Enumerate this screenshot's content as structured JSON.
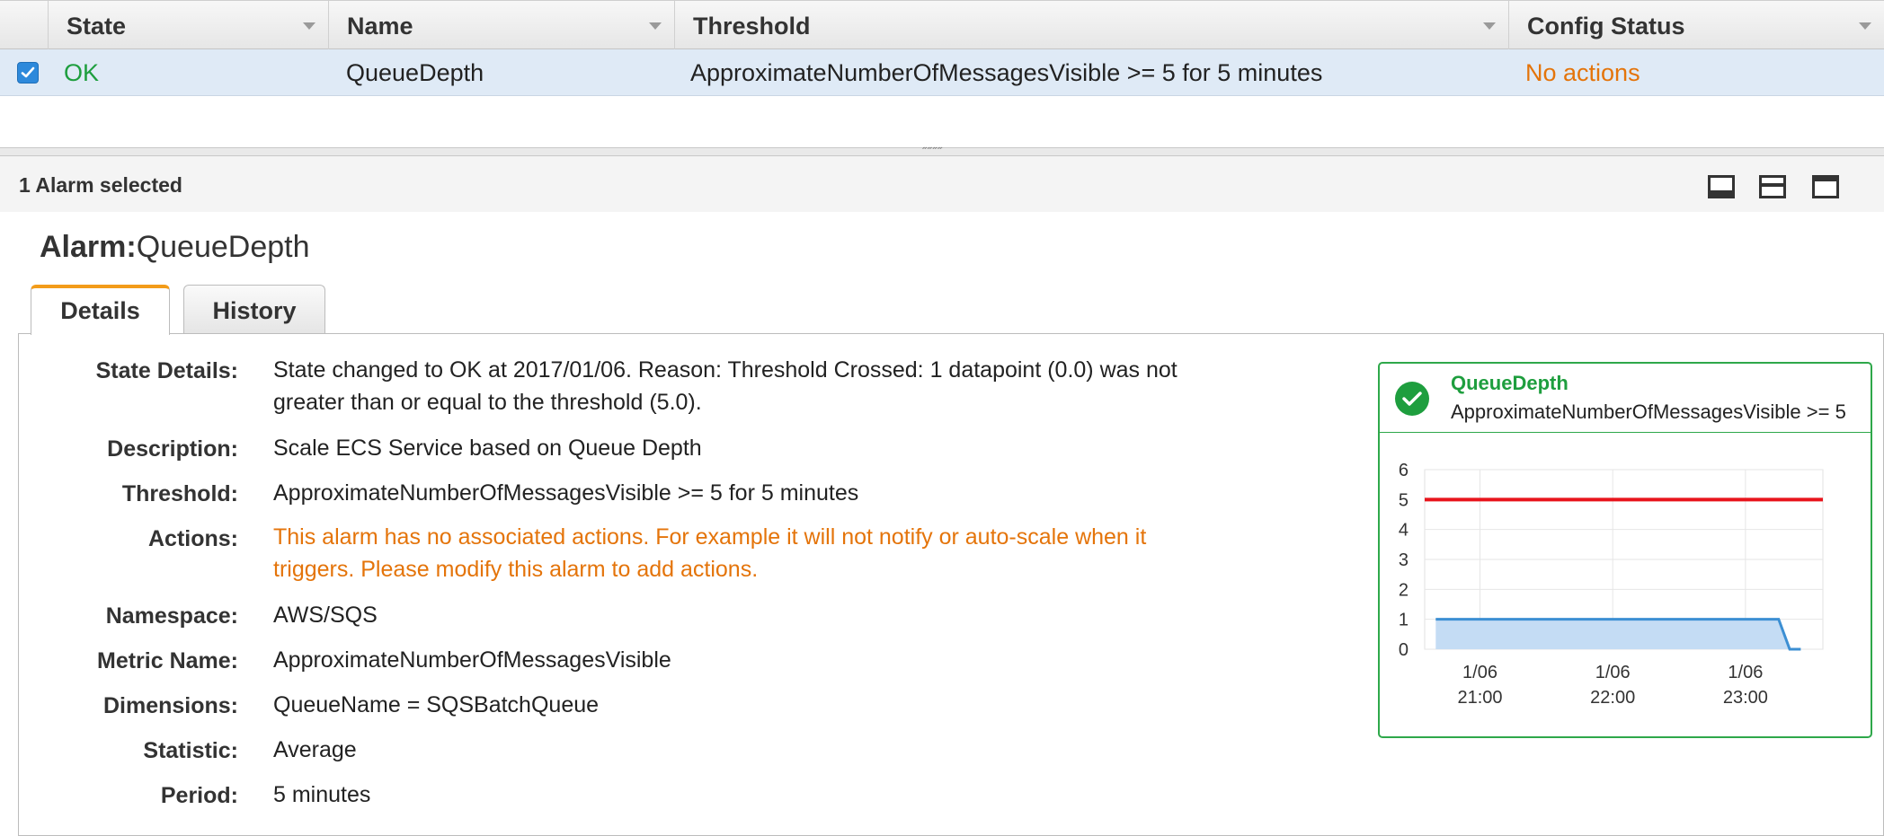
{
  "table": {
    "columns": [
      {
        "label": "State"
      },
      {
        "label": "Name"
      },
      {
        "label": "Threshold"
      },
      {
        "label": "Config Status"
      }
    ],
    "row": {
      "selected": true,
      "state": "OK",
      "name": "QueueDepth",
      "threshold": "ApproximateNumberOfMessagesVisible >= 5 for 5 minutes",
      "config_status": "No actions"
    }
  },
  "selection": {
    "count_text": "1 Alarm selected"
  },
  "alarm": {
    "title_label": "Alarm:",
    "title_name": "QueueDepth"
  },
  "tabs": [
    {
      "label": "Details",
      "active": true
    },
    {
      "label": "History",
      "active": false
    }
  ],
  "details": [
    {
      "label": "State Details:",
      "lines": [
        "State changed to OK at 2017/01/06. Reason: Threshold Crossed: 1 datapoint (0.0) was not",
        "greater than or equal to the threshold (5.0)."
      ]
    },
    {
      "label": "Description:",
      "lines": [
        "Scale ECS Service based on Queue Depth"
      ]
    },
    {
      "label": "Threshold:",
      "lines": [
        "ApproximateNumberOfMessagesVisible >= 5 for 5 minutes"
      ]
    },
    {
      "label": "Actions:",
      "lines": [
        "This alarm has no associated actions. For example it will not notify or auto-scale when it",
        "triggers. Please modify this alarm to add actions."
      ]
    },
    {
      "label": "Namespace:",
      "lines": [
        "AWS/SQS"
      ]
    },
    {
      "label": "Metric Name:",
      "lines": [
        "ApproximateNumberOfMessagesVisible"
      ]
    },
    {
      "label": "Dimensions:",
      "lines": [
        "QueueName = SQSBatchQueue"
      ]
    },
    {
      "label": "Statistic:",
      "lines": [
        "Average"
      ]
    },
    {
      "label": "Period:",
      "lines": [
        "5 minutes"
      ]
    }
  ],
  "widget": {
    "title": "QueueDepth",
    "subtitle": "ApproximateNumberOfMessagesVisible >= 5"
  },
  "colors": {
    "ok_green": "#1e9e3e",
    "warning_orange": "#e4740a",
    "active_tab_accent": "#f39c19",
    "threshold_line": "#e8141c",
    "metric_line": "#3c8fd3",
    "metric_fill": "#c4dcf4",
    "selected_row": "#dfeaf6"
  },
  "icons": {
    "checkbox": "checked-checkbox-icon",
    "widget_status": "check-circle-icon",
    "layout_buttons": [
      "panel-bottom-small-icon",
      "panel-bottom-large-icon",
      "panel-full-icon"
    ]
  },
  "chart_data": {
    "type": "line",
    "y_ticks": [
      6,
      5,
      4,
      3,
      2,
      1,
      0
    ],
    "ylim": [
      0,
      6
    ],
    "x_tick_labels": [
      [
        "1/06",
        "21:00"
      ],
      [
        "1/06",
        "22:00"
      ],
      [
        "1/06",
        "23:00"
      ]
    ],
    "threshold": 5,
    "series": [
      {
        "x": [
          "20:40",
          "20:45",
          "20:50",
          "20:55",
          "21:00",
          "21:05",
          "21:10",
          "21:15",
          "21:20",
          "21:25",
          "21:30",
          "21:35",
          "21:40",
          "21:45",
          "21:50",
          "21:55",
          "22:00",
          "22:05",
          "22:10",
          "22:15",
          "22:20",
          "22:25",
          "22:30",
          "22:35",
          "22:40",
          "22:45",
          "22:50",
          "22:55",
          "23:00",
          "23:05",
          "23:10",
          "23:15",
          "23:20",
          "23:25"
        ],
        "values": [
          1,
          1,
          1,
          1,
          1,
          1,
          1,
          1,
          1,
          1,
          1,
          1,
          1,
          1,
          1,
          1,
          1,
          1,
          1,
          1,
          1,
          1,
          1,
          1,
          1,
          1,
          1,
          1,
          1,
          1,
          1,
          1,
          0,
          0
        ]
      }
    ],
    "grid": true
  }
}
